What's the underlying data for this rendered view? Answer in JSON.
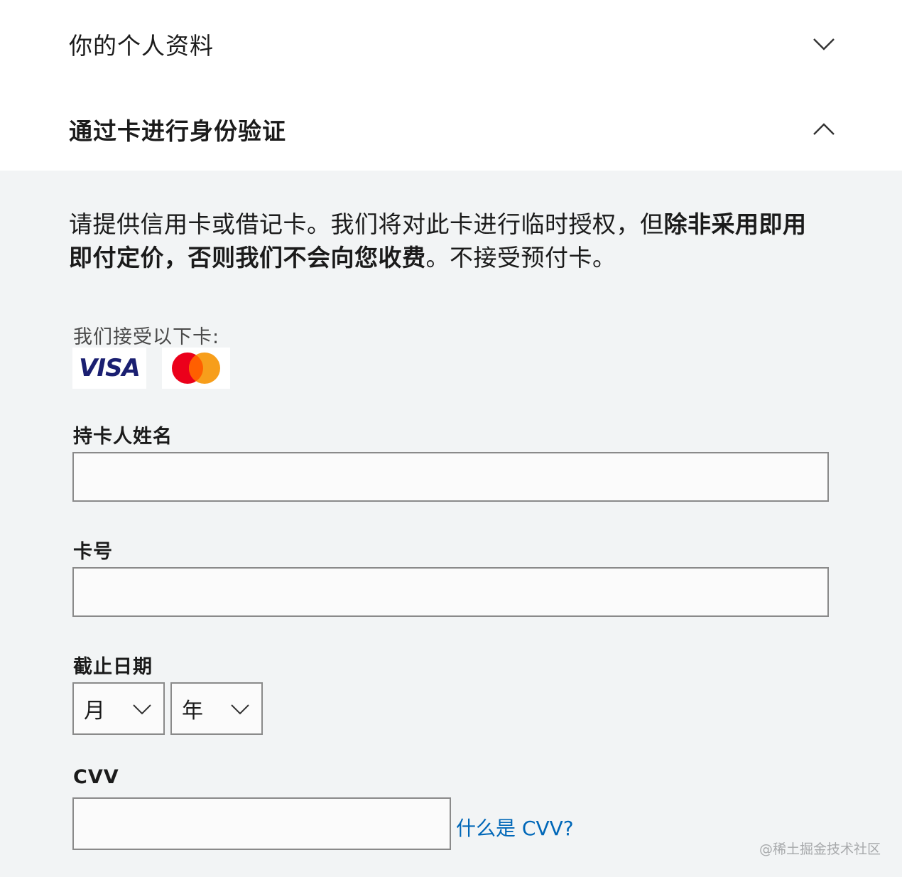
{
  "sections": {
    "profile_title": "你的个人资料",
    "verify_title": "通过卡进行身份验证"
  },
  "intro": {
    "part1": "请提供信用卡或借记卡。我们将对此卡进行临时授权，但",
    "bold": "除非采用即用即付定价，否则我们不会向您收费",
    "part2": "。不接受预付卡。"
  },
  "cards": {
    "label": "我们接受以下卡:",
    "visa_text": "VISA",
    "logos": [
      "visa-logo",
      "mastercard-logo"
    ],
    "mastercard_colors": {
      "red": "#eb001b",
      "orange": "#f79e1b",
      "overlap": "#ff5f00"
    }
  },
  "form": {
    "name_label": "持卡人姓名",
    "name_value": "",
    "number_label": "卡号",
    "number_value": "",
    "expiry_label": "截止日期",
    "month_placeholder": "月",
    "year_placeholder": "年",
    "cvv_label": "CVV",
    "cvv_value": "",
    "cvv_help": "什么是 CVV?"
  },
  "watermark": "@稀土掘金技术社区",
  "colors": {
    "link": "#0067b8",
    "panel_bg": "#f2f4f5",
    "input_border": "#8a8a8a"
  }
}
